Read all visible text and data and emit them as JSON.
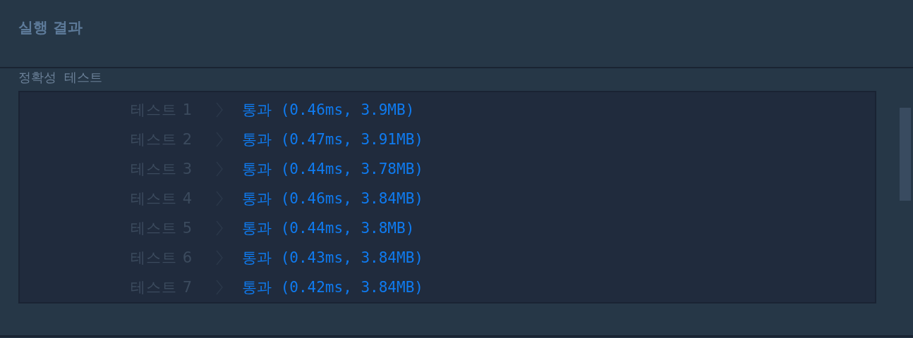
{
  "title": "실행 결과",
  "section_label": "정확성  테스트",
  "tests": [
    {
      "label": "테스트 1",
      "result": "통과 (0.46ms, 3.9MB)"
    },
    {
      "label": "테스트 2",
      "result": "통과 (0.47ms, 3.91MB)"
    },
    {
      "label": "테스트 3",
      "result": "통과 (0.44ms, 3.78MB)"
    },
    {
      "label": "테스트 4",
      "result": "통과 (0.46ms, 3.84MB)"
    },
    {
      "label": "테스트 5",
      "result": "통과 (0.44ms, 3.8MB)"
    },
    {
      "label": "테스트 6",
      "result": "통과 (0.43ms, 3.84MB)"
    },
    {
      "label": "테스트 7",
      "result": "통과 (0.42ms, 3.84MB)"
    }
  ]
}
